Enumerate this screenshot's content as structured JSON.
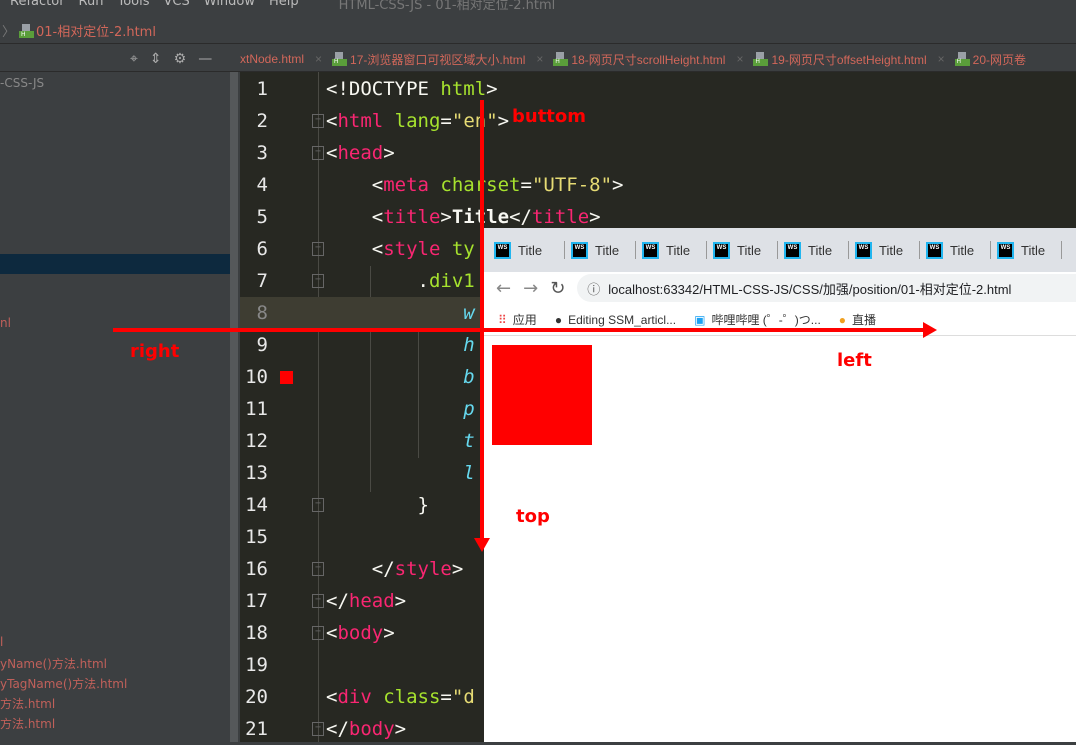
{
  "menu": [
    "Refactor",
    "Run",
    "Tools",
    "VCS",
    "Window",
    "Help"
  ],
  "window_title": "HTML-CSS-JS - 01-相对定位-2.html",
  "breadcrumb": "01-相对定位-2.html",
  "editor_tabs": [
    "xtNode.html",
    "17-浏览器窗口可视区域大小.html",
    "18-网页尺寸scrollHeight.html",
    "19-网页尺寸offsetHeight.html",
    "20-网页卷"
  ],
  "sidebar": {
    "project": "-CSS-JS",
    "items": [
      "nl",
      "l",
      "yName()方法.html",
      "yTagName()方法.html",
      "方法.html",
      "方法.html"
    ]
  },
  "code_lines": [
    [
      [
        "t",
        "<!DOCTYPE "
      ],
      [
        "attr",
        "html"
      ],
      [
        "t",
        ">"
      ]
    ],
    [
      [
        "t",
        "<"
      ],
      [
        "tag",
        "html "
      ],
      [
        "attr",
        "lang"
      ],
      [
        "t",
        "="
      ],
      [
        "str",
        "\"en\""
      ],
      [
        "t",
        ">"
      ]
    ],
    [
      [
        "t",
        "<"
      ],
      [
        "tag",
        "head"
      ],
      [
        "t",
        ">"
      ]
    ],
    [
      [
        "t",
        "    <"
      ],
      [
        "tag",
        "meta "
      ],
      [
        "attr",
        "charset"
      ],
      [
        "t",
        "="
      ],
      [
        "str",
        "\"UTF-8\""
      ],
      [
        "t",
        ">"
      ]
    ],
    [
      [
        "t",
        "    <"
      ],
      [
        "tag",
        "title"
      ],
      [
        "t",
        ">"
      ],
      [
        "bold",
        "Title"
      ],
      [
        "t",
        "</"
      ],
      [
        "tag",
        "title"
      ],
      [
        "t",
        ">"
      ]
    ],
    [
      [
        "t",
        "    <"
      ],
      [
        "tag",
        "style "
      ],
      [
        "attr",
        "ty"
      ]
    ],
    [
      [
        "t",
        "        ."
      ],
      [
        "attr",
        "div1"
      ]
    ],
    [
      [
        "t",
        "            "
      ],
      [
        "prop",
        "w"
      ]
    ],
    [
      [
        "t",
        "            "
      ],
      [
        "prop",
        "h"
      ]
    ],
    [
      [
        "t",
        "            "
      ],
      [
        "prop",
        "b"
      ]
    ],
    [
      [
        "t",
        "            "
      ],
      [
        "prop",
        "p"
      ]
    ],
    [
      [
        "t",
        "            "
      ],
      [
        "prop",
        "t"
      ]
    ],
    [
      [
        "t",
        "            "
      ],
      [
        "prop",
        "l"
      ]
    ],
    [
      [
        "t",
        "        }"
      ]
    ],
    [
      [
        "t",
        ""
      ]
    ],
    [
      [
        "t",
        "    </"
      ],
      [
        "tag",
        "style"
      ],
      [
        "t",
        ">"
      ]
    ],
    [
      [
        "t",
        "</"
      ],
      [
        "tag",
        "head"
      ],
      [
        "t",
        ">"
      ]
    ],
    [
      [
        "t",
        "<"
      ],
      [
        "tag",
        "body"
      ],
      [
        "t",
        ">"
      ]
    ],
    [
      [
        "t",
        ""
      ]
    ],
    [
      [
        "t",
        "<"
      ],
      [
        "tag",
        "div "
      ],
      [
        "attr",
        "class"
      ],
      [
        "t",
        "="
      ],
      [
        "str",
        "\"d"
      ]
    ],
    [
      [
        "t",
        "</"
      ],
      [
        "tag",
        "body"
      ],
      [
        "t",
        ">"
      ]
    ]
  ],
  "browser": {
    "tab_title": "Title",
    "tab_count": 8,
    "url": "localhost:63342/HTML-CSS-JS/CSS/加强/position/01-相对定位-2.html",
    "bookmarks": [
      "应用",
      "Editing SSM_articl...",
      "哔哩哔哩 (゜-゜)つ...",
      "直播"
    ]
  },
  "annotations": {
    "bottom": "buttom",
    "right": "right",
    "left": "left",
    "top": "top"
  },
  "colors": {
    "accent": "#ff0000"
  }
}
